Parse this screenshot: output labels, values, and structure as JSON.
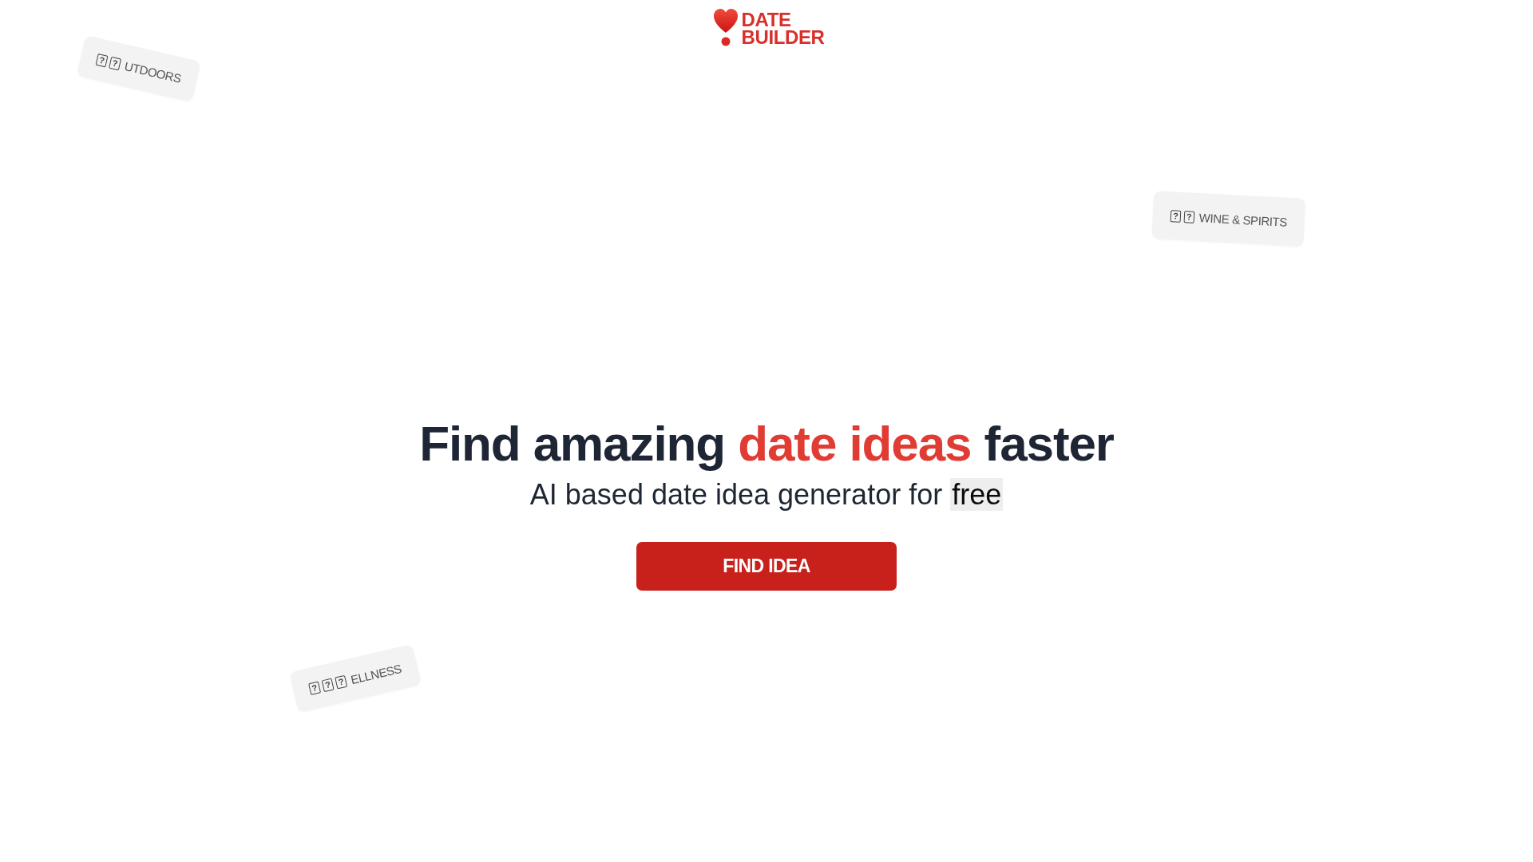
{
  "logo": {
    "lines": [
      "DATE",
      "BUILDER"
    ]
  },
  "tags": [
    {
      "glyphs": [
        "?",
        "?"
      ],
      "label": "UTDOORS"
    },
    {
      "glyphs": [
        "?",
        "?"
      ],
      "label": "WINE & SPIRITS"
    },
    {
      "glyphs": [
        "?",
        "?",
        "?"
      ],
      "label": "ELLNESS"
    }
  ],
  "hero": {
    "headline": [
      {
        "text": "Find amazing ",
        "accent": false
      },
      {
        "text": "date ideas",
        "accent": true
      },
      {
        "text": " faster",
        "accent": false
      }
    ],
    "subtitle": [
      {
        "text": "AI based date idea generator for ",
        "highlight": false
      },
      {
        "text": "free",
        "highlight": true
      }
    ],
    "button": "FIND IDEA"
  }
}
